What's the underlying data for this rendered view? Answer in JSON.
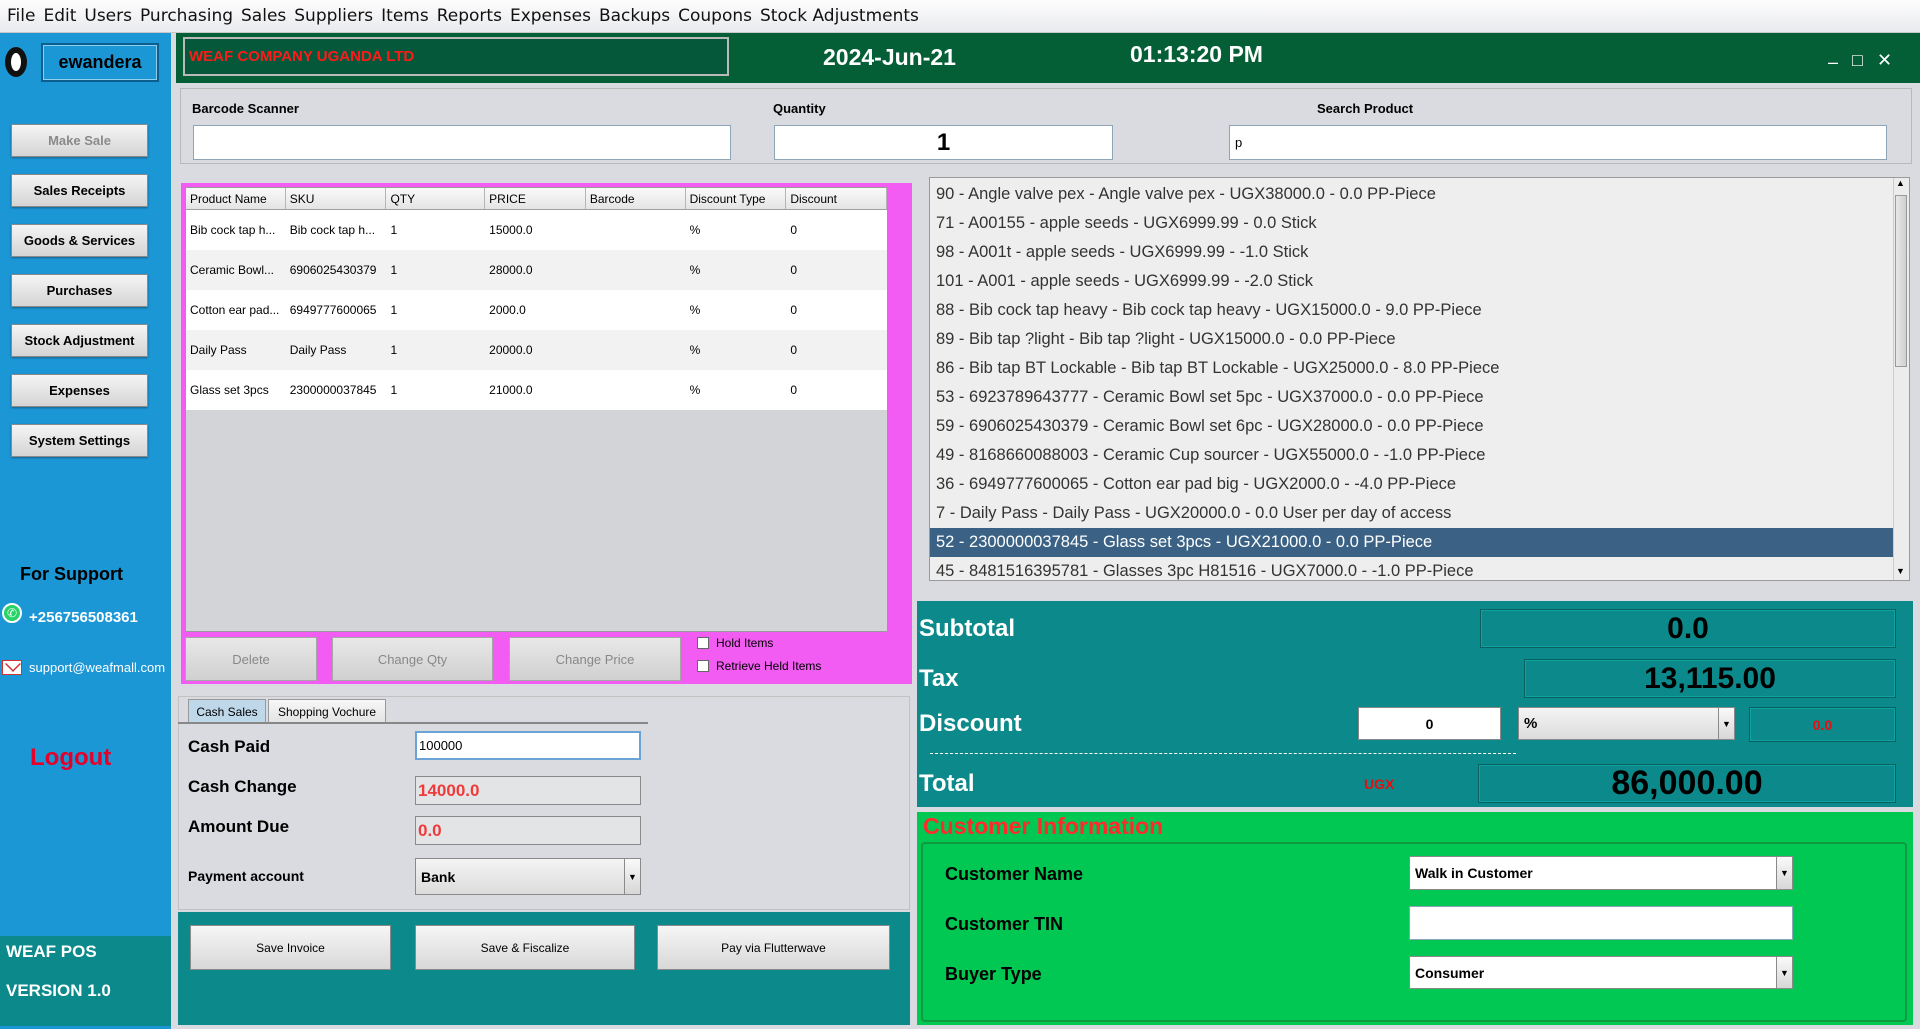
{
  "menu": [
    "File",
    "Edit",
    "Users",
    "Purchasing",
    "Sales",
    "Suppliers",
    "Items",
    "Reports",
    "Expenses",
    "Backups",
    "Coupons",
    "Stock Adjustments"
  ],
  "sidebar": {
    "username": "ewandera",
    "buttons": [
      "Make  Sale",
      "Sales Receipts",
      "Goods & Services",
      "Purchases",
      "Stock Adjustment",
      "Expenses",
      "System Settings"
    ],
    "support_title": "For Support",
    "phone": "+256756508361",
    "email": "support@weafmall.com",
    "logout": "Logout",
    "app_name": "WEAF POS",
    "app_version": "VERSION 1.0"
  },
  "header": {
    "company": "WEAF COMPANY UGANDA LTD",
    "date": "2024-Jun-21",
    "time": "01:13:20 PM"
  },
  "inputs": {
    "barcode_label": "Barcode Scanner",
    "barcode_value": "",
    "quantity_label": "Quantity",
    "quantity_value": "1",
    "search_label": "Search Product",
    "search_value": "p"
  },
  "cart": {
    "columns": [
      "Product Name",
      "SKU",
      "QTY",
      "PRICE",
      "Barcode",
      "Discount Type",
      "Discount"
    ],
    "rows": [
      [
        "Bib cock tap h...",
        "Bib cock tap h...",
        "1",
        "15000.0",
        "",
        "%",
        "0"
      ],
      [
        "Ceramic  Bowl...",
        "6906025430379",
        "1",
        "28000.0",
        "",
        "%",
        "0"
      ],
      [
        "Cotton ear pad...",
        "6949777600065",
        "1",
        "2000.0",
        "",
        "%",
        "0"
      ],
      [
        "Daily Pass",
        "Daily Pass",
        "1",
        "20000.0",
        "",
        "%",
        "0"
      ],
      [
        "Glass set 3pcs",
        "2300000037845",
        "1",
        "21000.0",
        "",
        "%",
        "0"
      ]
    ],
    "delete_label": "Delete",
    "change_qty_label": "Change Qty",
    "change_price_label": "Change Price",
    "hold_label": "Hold Items",
    "retrieve_label": "Retrieve Held Items"
  },
  "payment": {
    "tabs": [
      "Cash Sales",
      "Shopping Vochure"
    ],
    "cash_paid_label": "Cash Paid",
    "cash_paid_value": "100000",
    "cash_change_label": "Cash Change",
    "cash_change_value": "14000.0",
    "amount_due_label": "Amount Due",
    "amount_due_value": "0.0",
    "account_label": "Payment account",
    "account_value": "Bank",
    "save_invoice": "Save Invoice",
    "save_fiscalize": "Save & Fiscalize",
    "pay_flutterwave": "Pay via Flutterwave"
  },
  "products": [
    "90 - Angle valve pex - Angle valve pex - UGX38000.0 - 0.0 PP-Piece",
    "71 - A00155 - apple seeds - UGX6999.99 - 0.0 Stick",
    "98 - A001t - apple seeds - UGX6999.99 - -1.0 Stick",
    "101 - A001 - apple seeds - UGX6999.99 - -2.0 Stick",
    "88 - Bib cock tap heavy - Bib cock tap heavy - UGX15000.0 - 9.0 PP-Piece",
    "89 - Bib tap ?light - Bib tap ?light - UGX15000.0 - 0.0 PP-Piece",
    "86 - Bib tap BT Lockable - Bib tap BT Lockable - UGX25000.0 - 8.0 PP-Piece",
    "53 - 6923789643777 - Ceramic  Bowl set 5pc - UGX37000.0 - 0.0 PP-Piece",
    "59 - 6906025430379 - Ceramic  Bowl set 6pc - UGX28000.0 - 0.0 PP-Piece",
    "49 - 8168660088003 - Ceramic  Cup sourcer - UGX55000.0 - -1.0 PP-Piece",
    "36 - 6949777600065 - Cotton ear pad big - UGX2000.0 - -4.0 PP-Piece",
    "7 - Daily Pass - Daily Pass - UGX20000.0 - 0.0 User per day of access",
    "52 - 2300000037845 - Glass set 3pcs - UGX21000.0 - 0.0 PP-Piece",
    "45 - 8481516395781 - Glasses 3pc H81516 - UGX7000.0 - -1.0 PP-Piece"
  ],
  "selected_product_index": 12,
  "totals": {
    "subtotal_label": "Subtotal",
    "subtotal_value": "0.0",
    "tax_label": "Tax",
    "tax_value": "13,115.00",
    "discount_label": "Discount",
    "discount_value": "0",
    "discount_type": "%",
    "discount_amount": "0.0",
    "total_label": "Total",
    "currency": "UGX",
    "total_value": "86,000.00"
  },
  "customer": {
    "title": "Customer Information",
    "name_label": "Customer Name",
    "name_value": "Walk in Customer",
    "tin_label": "Customer TIN",
    "tin_value": "",
    "buyer_label": "Buyer Type",
    "buyer_value": "Consumer"
  },
  "colors": {
    "sidebar": "#1c97d6",
    "header": "#045f36",
    "teal": "#0c8a8b",
    "cart_border": "#f25cf2",
    "customer_bg": "#00c853",
    "accent_red": "#ff2a2a",
    "selection": "#3b6285"
  }
}
